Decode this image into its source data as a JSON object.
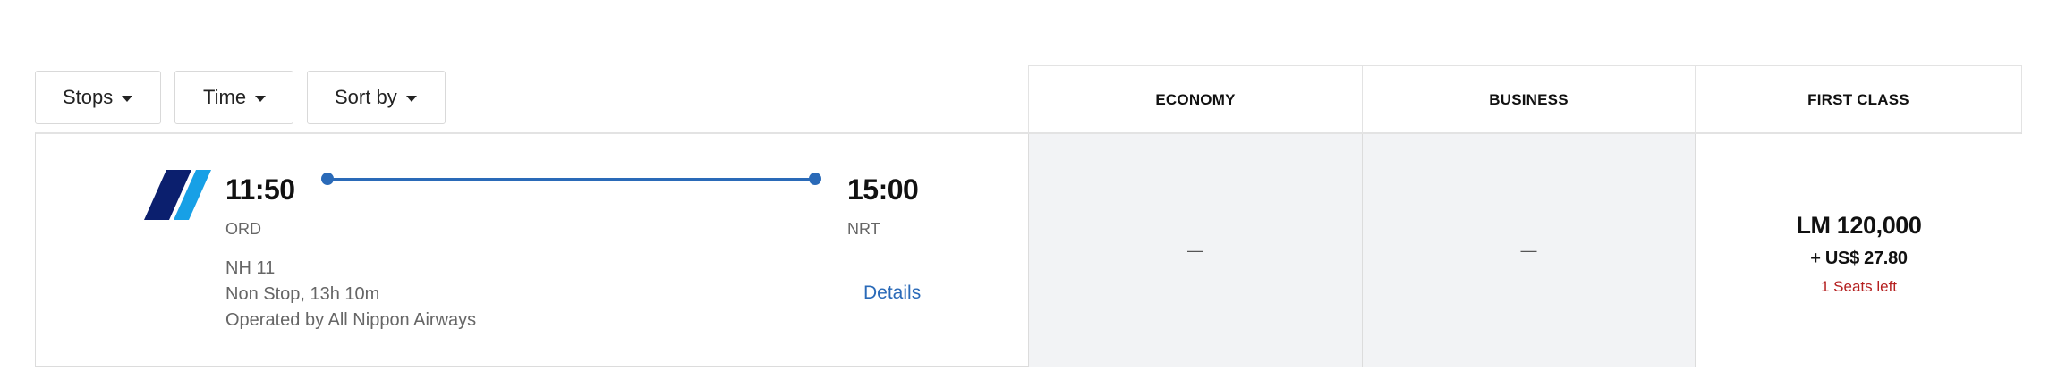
{
  "filters": {
    "stops_label": "Stops",
    "time_label": "Time",
    "sort_label": "Sort by"
  },
  "cabins": {
    "economy": "ECONOMY",
    "business": "BUSINESS",
    "first": "FIRST CLASS"
  },
  "flight": {
    "airline_logo_icon": "airline-stripes-logo",
    "departure_time": "11:50",
    "arrival_time": "15:00",
    "departure_airport": "ORD",
    "arrival_airport": "NRT",
    "flight_number": "NH 11",
    "duration": "Non Stop, 13h 10m",
    "operator": "Operated by All Nippon Airways",
    "details_label": "Details",
    "colors": {
      "route_line": "#2a6ab8",
      "logo_dark": "#0b1f6e",
      "logo_light": "#17a0e6"
    }
  },
  "fares": {
    "economy": "—",
    "business": "—",
    "first": {
      "points": "LM 120,000",
      "cash": "+ US$ 27.80",
      "seats": "1 Seats left",
      "seats_color": "#b52020"
    }
  }
}
